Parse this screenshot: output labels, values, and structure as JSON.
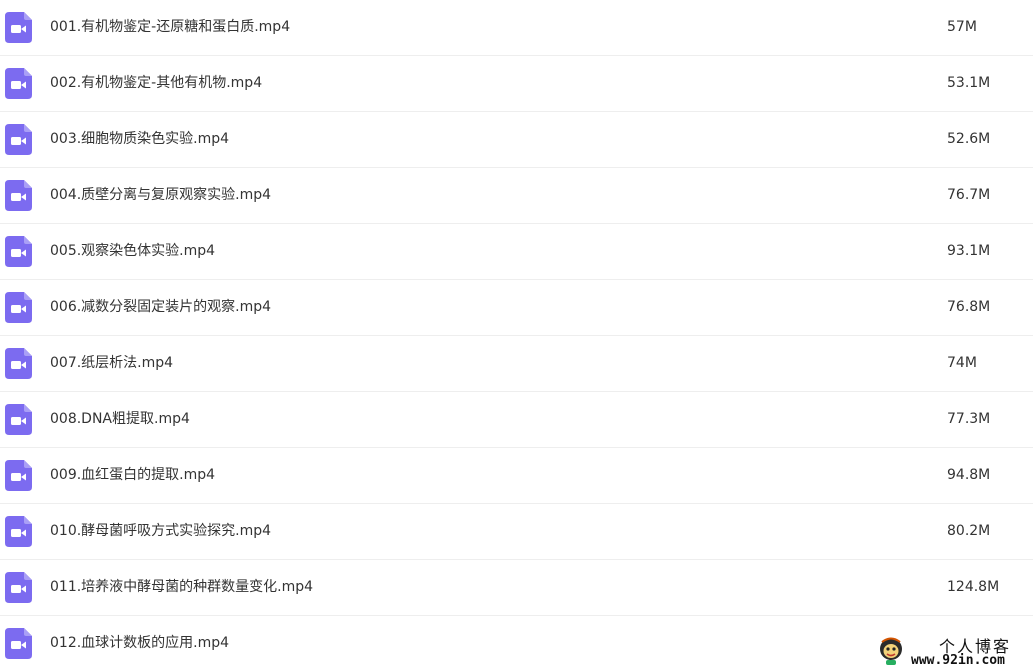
{
  "colors": {
    "icon_purple": "#7c6bf0",
    "text": "#333333",
    "divider": "#eeeeee"
  },
  "files": [
    {
      "name": "001.有机物鉴定-还原糖和蛋白质.mp4",
      "size": "57M",
      "icon": "video-file-icon"
    },
    {
      "name": "002.有机物鉴定-其他有机物.mp4",
      "size": "53.1M",
      "icon": "video-file-icon"
    },
    {
      "name": "003.细胞物质染色实验.mp4",
      "size": "52.6M",
      "icon": "video-file-icon"
    },
    {
      "name": "004.质壁分离与复原观察实验.mp4",
      "size": "76.7M",
      "icon": "video-file-icon"
    },
    {
      "name": "005.观察染色体实验.mp4",
      "size": "93.1M",
      "icon": "video-file-icon"
    },
    {
      "name": "006.减数分裂固定装片的观察.mp4",
      "size": "76.8M",
      "icon": "video-file-icon"
    },
    {
      "name": "007.纸层析法.mp4",
      "size": "74M",
      "icon": "video-file-icon"
    },
    {
      "name": "008.DNA粗提取.mp4",
      "size": "77.3M",
      "icon": "video-file-icon"
    },
    {
      "name": "009.血红蛋白的提取.mp4",
      "size": "94.8M",
      "icon": "video-file-icon"
    },
    {
      "name": "010.酵母菌呼吸方式实验探究.mp4",
      "size": "80.2M",
      "icon": "video-file-icon"
    },
    {
      "name": "011.培养液中酵母菌的种群数量变化.mp4",
      "size": "124.8M",
      "icon": "video-file-icon"
    },
    {
      "name": "012.血球计数板的应用.mp4",
      "size": "",
      "icon": "video-file-icon"
    }
  ],
  "watermark": {
    "title": "个人博客",
    "url": "www.92in.com",
    "logo_icon": "cartoon-mascot-icon"
  }
}
